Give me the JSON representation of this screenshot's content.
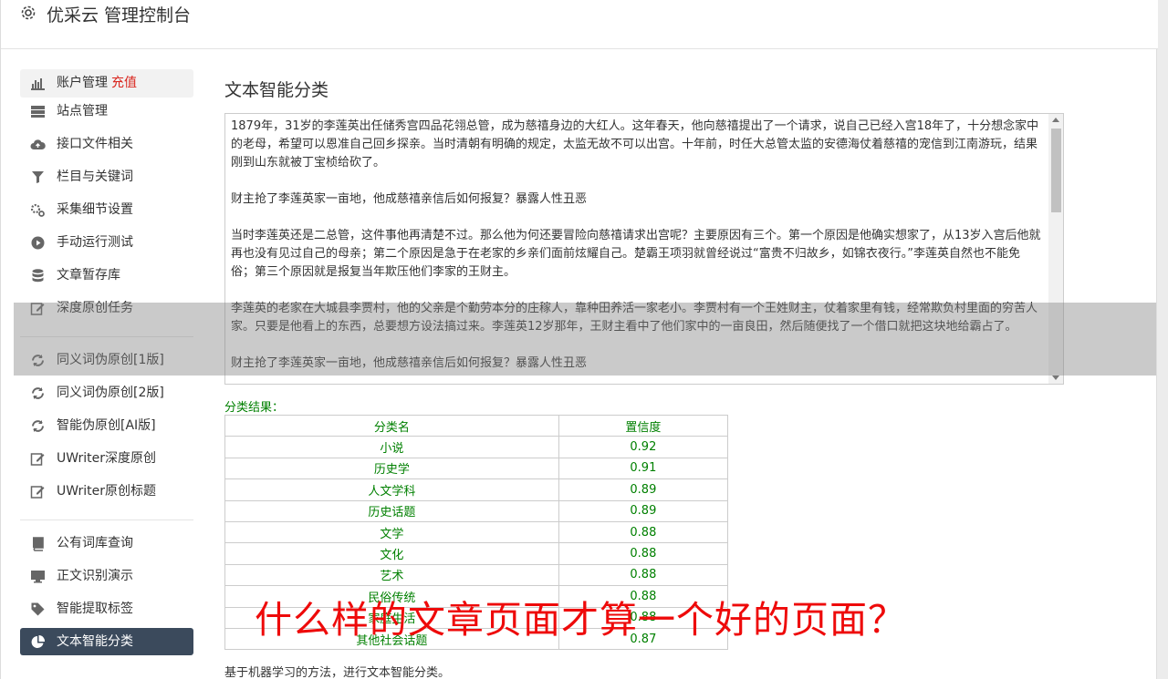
{
  "app": {
    "title": "优采云 管理控制台"
  },
  "sidebar": {
    "recharge_label": "充值",
    "group1": [
      {
        "label": "账户管理",
        "icon": "bar-chart-icon"
      },
      {
        "label": "站点管理",
        "icon": "server-icon"
      },
      {
        "label": "接口文件相关",
        "icon": "cloud-upload-icon"
      },
      {
        "label": "栏目与关键词",
        "icon": "filter-icon"
      },
      {
        "label": "采集细节设置",
        "icon": "gears-icon"
      },
      {
        "label": "手动运行测试",
        "icon": "play-circle-icon"
      },
      {
        "label": "文章暂存库",
        "icon": "database-icon"
      },
      {
        "label": "深度原创任务",
        "icon": "edit-icon"
      }
    ],
    "group2": [
      {
        "label": "同义词伪原创[1版]",
        "icon": "refresh-icon"
      },
      {
        "label": "同义词伪原创[2版]",
        "icon": "refresh-icon"
      },
      {
        "label": "智能伪原创[AI版]",
        "icon": "refresh-icon"
      },
      {
        "label": "UWriter深度原创",
        "icon": "edit-icon"
      },
      {
        "label": "UWriter原创标题",
        "icon": "edit-icon"
      }
    ],
    "group3": [
      {
        "label": "公有词库查询",
        "icon": "book-icon"
      },
      {
        "label": "正文识别演示",
        "icon": "monitor-icon"
      },
      {
        "label": "智能提取标签",
        "icon": "tag-icon"
      },
      {
        "label": "文本智能分类",
        "icon": "pie-chart-icon"
      }
    ]
  },
  "main": {
    "title": "文本智能分类",
    "textarea_value": "1879年，31岁的李莲英出任储秀宫四品花翎总管，成为慈禧身边的大红人。这年春天，他向慈禧提出了一个请求，说自己已经入宫18年了，十分想念家中的老母，希望可以恩准自己回乡探亲。当时清朝有明确的规定，太监无故不可以出宫。十年前，时任大总管太监的安德海仗着慈禧的宠信到江南游玩，结果刚到山东就被丁宝桢给砍了。\n\n财主抢了李莲英家一亩地，他成慈禧亲信后如何报复？暴露人性丑恶\n\n当时李莲英还是二总管，这件事他再清楚不过。那么他为何还要冒险向慈禧请求出宫呢？主要原因有三个。第一个原因是他确实想家了，从13岁入宫后他就再也没有见过自己的母亲；第二个原因是急于在老家的乡亲们面前炫耀自己。楚霸王项羽就曾经说过“富贵不归故乡，如锦衣夜行。”李莲英自然也不能免俗；第三个原因就是报复当年欺压他们李家的王财主。\n\n李莲英的老家在大城县李贾村，他的父亲是个勤劳本分的庄稼人，靠种田养活一家老小。李贾村有一个王姓财主，仗着家里有钱，经常欺负村里面的穷苦人家。只要是他看上的东西，总要想方设法搞过来。李莲英12岁那年，王财主看中了他们家中的一亩良田，然后随便找了一个借口就把这块地给霸占了。\n\n财主抢了李莲英家一亩地，他成慈禧亲信后如何报复？暴露人性丑恶",
    "result_label": "分类结果：",
    "table_headers": [
      "分类名",
      "置信度"
    ],
    "rows": [
      [
        "小说",
        "0.92"
      ],
      [
        "历史学",
        "0.91"
      ],
      [
        "人文学科",
        "0.89"
      ],
      [
        "历史话题",
        "0.89"
      ],
      [
        "文学",
        "0.88"
      ],
      [
        "文化",
        "0.88"
      ],
      [
        "艺术",
        "0.88"
      ],
      [
        "民俗传统",
        "0.88"
      ],
      [
        "家庭生活",
        "0.88"
      ],
      [
        "其他社会话题",
        "0.87"
      ]
    ],
    "footnote": "基于机器学习的方法，进行文本智能分类。"
  },
  "overlay_caption": "什么样的文章页面才算一个好的页面？",
  "colors": {
    "active_bg": "#3b4a5c",
    "result_green": "#008000",
    "recharge_red": "#d9251d",
    "caption_red": "#ee0a0a"
  }
}
